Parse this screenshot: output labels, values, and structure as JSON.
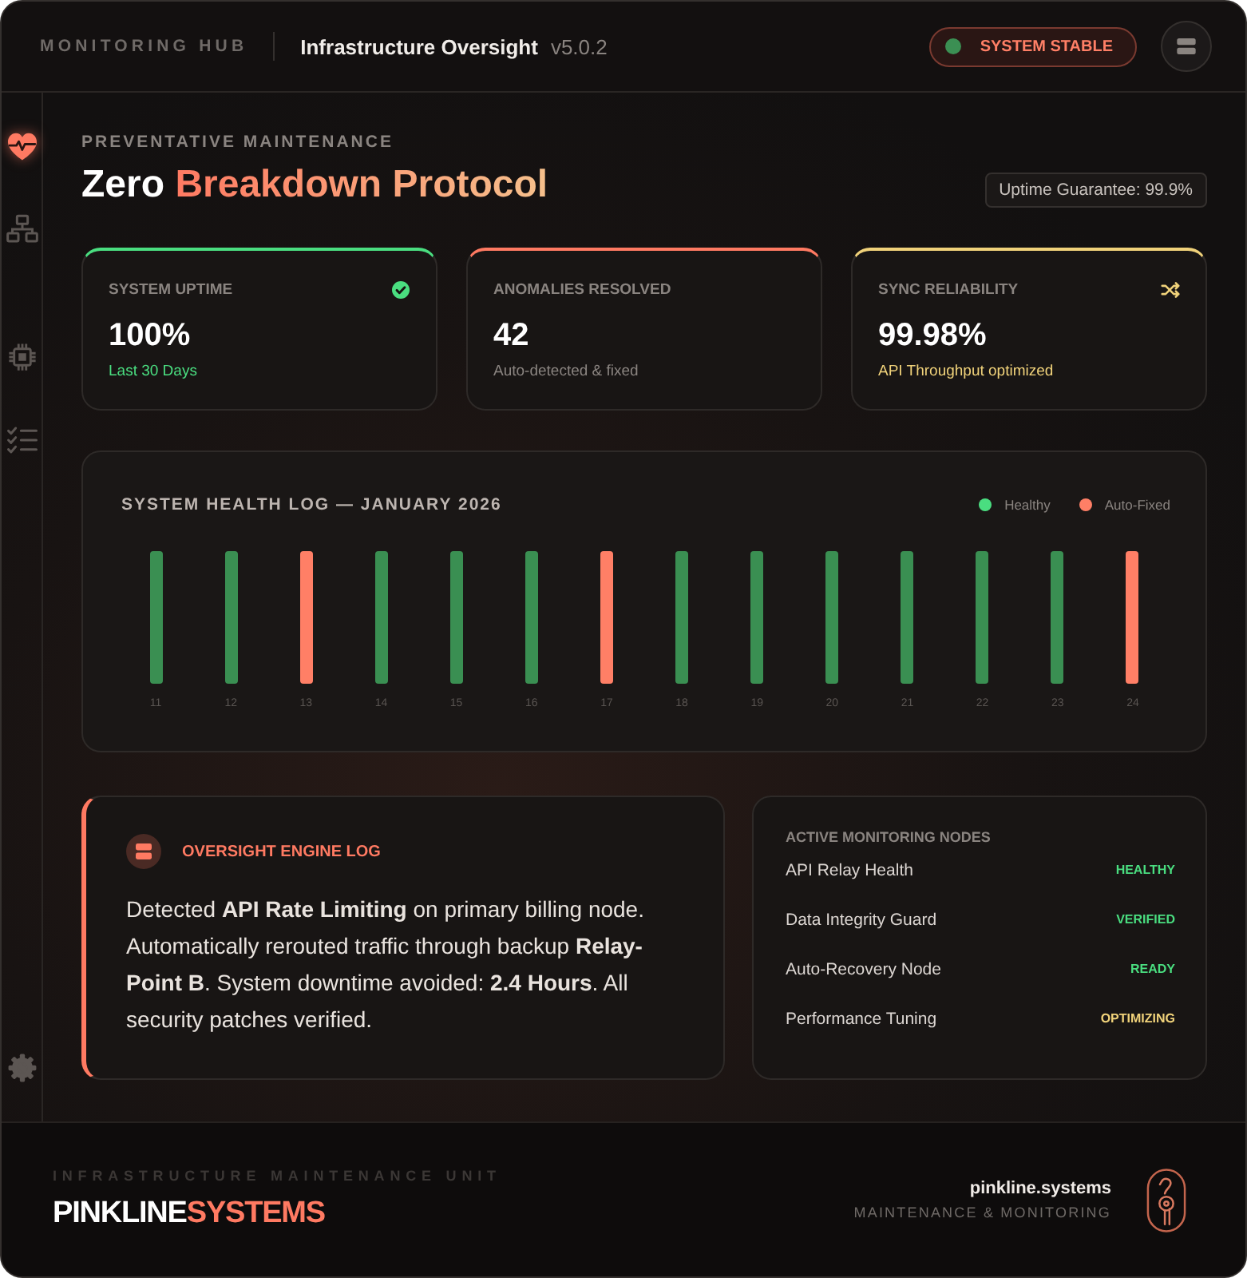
{
  "header": {
    "brand": "MONITORING HUB",
    "title": "Infrastructure Oversight",
    "version": "v5.0.2",
    "status": "SYSTEM STABLE"
  },
  "sidebar": {
    "items": [
      {
        "kind": "health",
        "selected": true
      },
      {
        "kind": "network",
        "selected": false
      },
      {
        "kind": "chip",
        "selected": false
      },
      {
        "kind": "tasks",
        "selected": false
      }
    ]
  },
  "heading": {
    "eyebrow": "PREVENTATIVE MAINTENANCE",
    "title": "Zero",
    "title_highlight": "Breakdown Protocol",
    "badge": "Uptime Guarantee: 99.9%"
  },
  "cards": [
    {
      "kind": "uptime",
      "label": "SYSTEM UPTIME",
      "value": "100%",
      "note": "Last 30 Days",
      "color": "#4ade80",
      "note_highlighted": true
    },
    {
      "kind": "count",
      "label": "ANOMALIES RESOLVED",
      "value": "42",
      "note": "Auto-detected & fixed",
      "color": "#ff7a62",
      "note_highlighted": false
    },
    {
      "kind": "sync",
      "label": "SYNC RELIABILITY",
      "value": "99.98%",
      "note": "API Throughput optimized",
      "color": "#f0d27a",
      "note_highlighted": true
    }
  ],
  "health_log": {
    "title": "SYSTEM HEALTH LOG — JANUARY 2026",
    "legend": [
      {
        "label": "Healthy",
        "color": "#4ade80"
      },
      {
        "label": "Auto-Fixed",
        "color": "#ff7f66"
      }
    ],
    "days": [
      {
        "label": "11",
        "color": "#3a8f52"
      },
      {
        "label": "12",
        "color": "#3a8f52"
      },
      {
        "label": "13",
        "color": "#ff7f66"
      },
      {
        "label": "14",
        "color": "#3a8f52"
      },
      {
        "label": "15",
        "color": "#3a8f52"
      },
      {
        "label": "16",
        "color": "#3a8f52"
      },
      {
        "label": "17",
        "color": "#ff7f66"
      },
      {
        "label": "18",
        "color": "#3a8f52"
      },
      {
        "label": "19",
        "color": "#3a8f52"
      },
      {
        "label": "20",
        "color": "#3a8f52"
      },
      {
        "label": "21",
        "color": "#3a8f52"
      },
      {
        "label": "22",
        "color": "#3a8f52"
      },
      {
        "label": "23",
        "color": "#3a8f52"
      },
      {
        "label": "24",
        "color": "#ff7f66"
      }
    ]
  },
  "log": {
    "title": "OVERSIGHT ENGINE LOG",
    "text": "Detected **API Rate Limiting** on primary billing node. Automatically rerouted traffic through backup **Relay-Point B**. System downtime avoided: **2.4 Hours**. All security patches verified."
  },
  "nodes": {
    "title": "ACTIVE MONITORING NODES",
    "items": [
      {
        "name": "API Relay Health",
        "status": "HEALTHY",
        "color": "#4ade80"
      },
      {
        "name": "Data Integrity Guard",
        "status": "VERIFIED",
        "color": "#4ade80"
      },
      {
        "name": "Auto-Recovery Node",
        "status": "READY",
        "color": "#4ade80"
      },
      {
        "name": "Performance Tuning",
        "status": "OPTIMIZING",
        "color": "#f0d27a"
      }
    ]
  },
  "footer": {
    "tagline": "INFRASTRUCTURE MAINTENANCE UNIT",
    "wordmark": "PINKLINE",
    "wordmark_accent": "SYSTEMS",
    "site": "pinkline.systems",
    "subtitle": "MAINTENANCE & MONITORING"
  }
}
